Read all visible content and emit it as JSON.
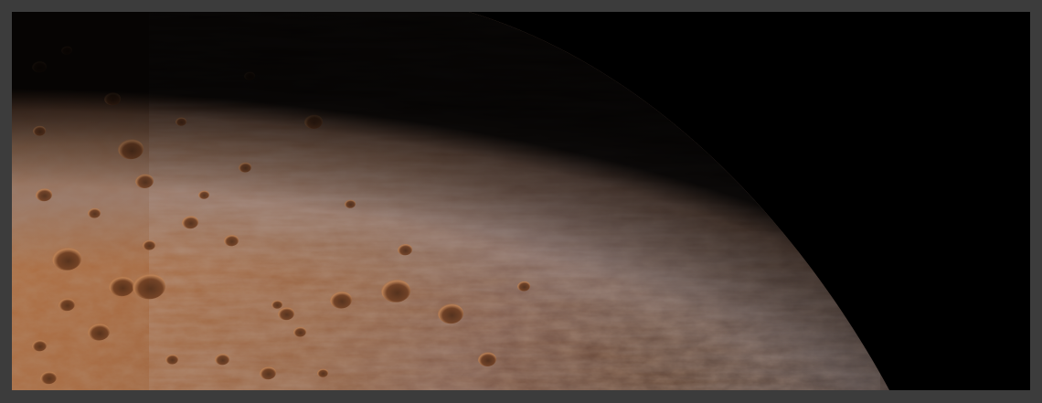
{
  "scene": {
    "subject": "planet-limb",
    "colors": {
      "frame": "#3c3c3c",
      "space": "#000000",
      "surface_bright": "#b87848",
      "surface_mid": "#9a5f38",
      "haze": "#8a7a78",
      "limb_dark": "#2a1a12",
      "crater_shadow": "#5a3018",
      "crater_rim": "#d49a68"
    }
  }
}
